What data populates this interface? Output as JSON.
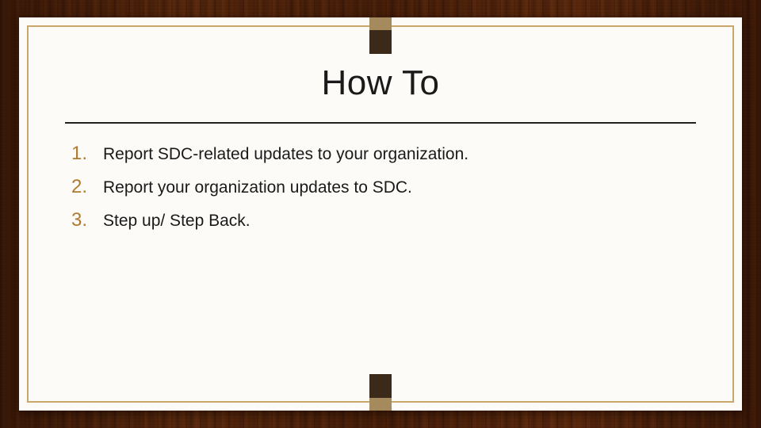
{
  "title": "How To",
  "items": [
    {
      "num": "1.",
      "text": "Report SDC-related updates to your organization."
    },
    {
      "num": "2.",
      "text": "Report your organization updates to SDC."
    },
    {
      "num": "3.",
      "text": "Step up/ Step Back."
    }
  ]
}
